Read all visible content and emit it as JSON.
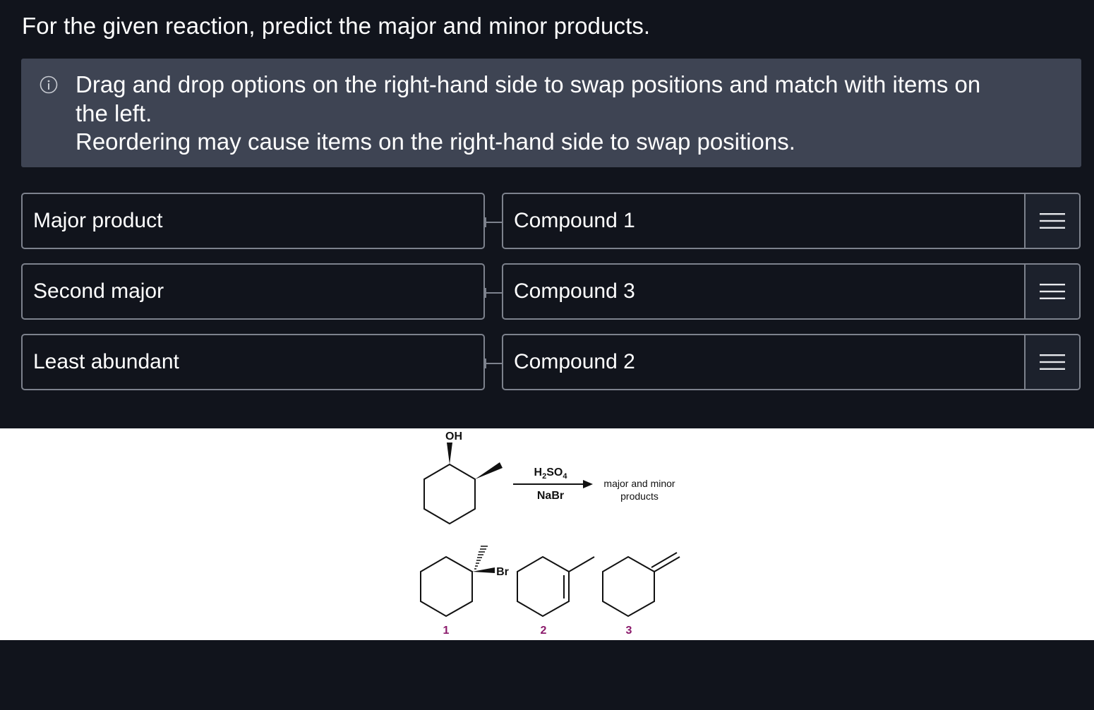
{
  "question": "For the given reaction, predict the major and minor products.",
  "info": {
    "icon": "info-circle-icon",
    "line1": "Drag and drop options on the right-hand side to swap positions and match with items on",
    "line2": "the left.",
    "line3": "Reordering may cause items on the right-hand side to swap positions."
  },
  "matching": {
    "left": [
      "Major product",
      "Second major",
      "Least abundant"
    ],
    "right": [
      "Compound 1",
      "Compound 3",
      "Compound 2"
    ],
    "handle_icon": "drag-handle-icon"
  },
  "reaction": {
    "reactant_group": "OH",
    "reagent_top_main": "H",
    "reagent_top_sub1": "2",
    "reagent_top_mid": "SO",
    "reagent_top_sub2": "4",
    "reagent_bottom": "NaBr",
    "products_line1": "major and minor",
    "products_line2": "products",
    "product_1_substituent": "Br",
    "label_1": "1",
    "label_2": "2",
    "label_3": "3",
    "label_color": "#8b1a6b"
  }
}
